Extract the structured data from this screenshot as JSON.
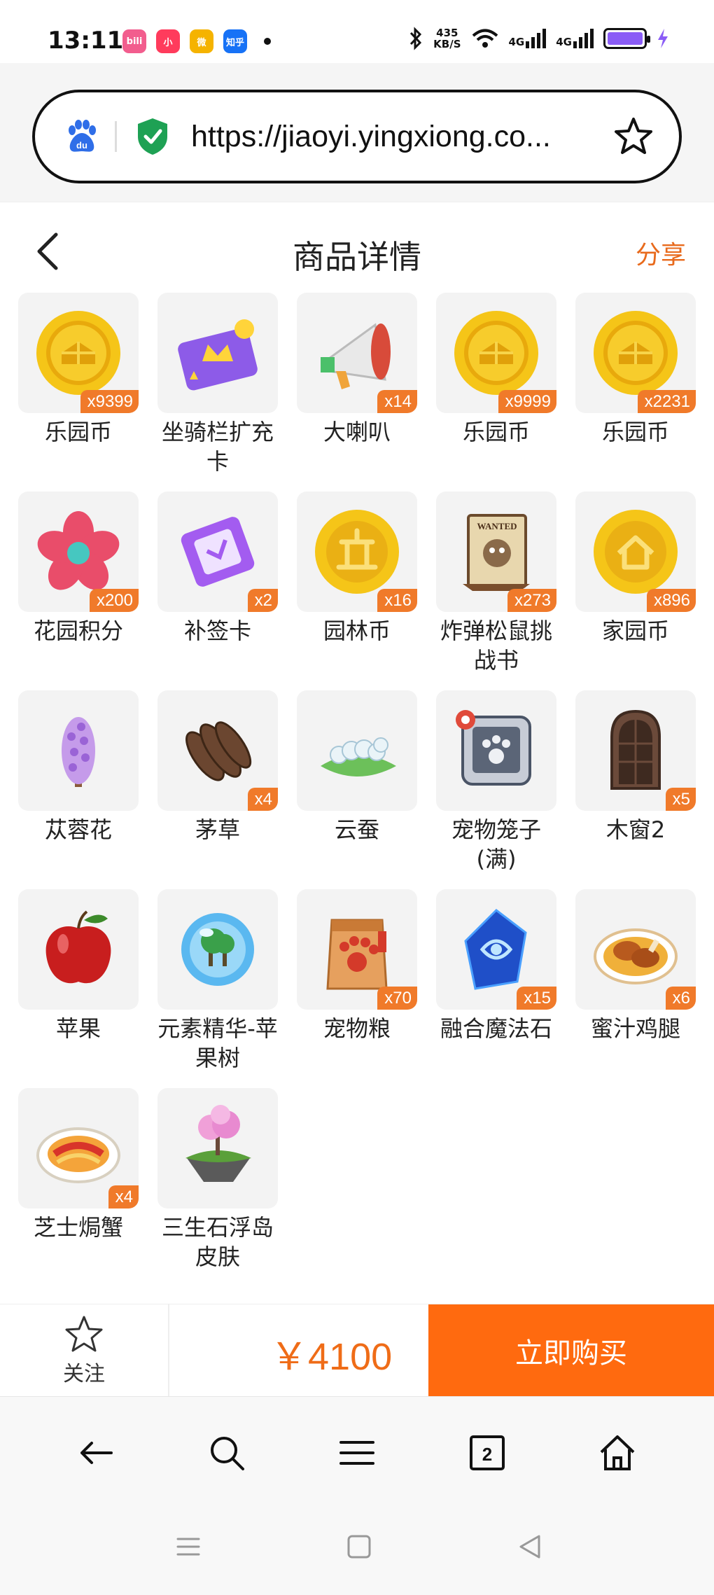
{
  "status_bar": {
    "time": "13:11",
    "net_speed_value": "435",
    "net_speed_unit": "KB/S",
    "network_label": "4G",
    "apps": [
      {
        "label": "bili",
        "color": "#f25d8e"
      },
      {
        "label": "小",
        "color": "#ff3b5c"
      },
      {
        "label": "微",
        "color": "#f5b300"
      },
      {
        "label": "知乎",
        "color": "#1772f6"
      }
    ],
    "battery_color": "#8a5cf6"
  },
  "browser": {
    "url": "https://jiaoyi.yingxiong.co..."
  },
  "header": {
    "title": "商品详情",
    "share_label": "分享"
  },
  "items": [
    {
      "name": "乐园币",
      "qty": "x9399",
      "icon": "coin-icon"
    },
    {
      "name": "坐骑栏扩充卡",
      "qty": "",
      "icon": "mount-card-icon"
    },
    {
      "name": "大喇叭",
      "qty": "x14",
      "icon": "megaphone-icon"
    },
    {
      "name": "乐园币",
      "qty": "x9999",
      "icon": "coin-icon"
    },
    {
      "name": "乐园币",
      "qty": "x2231",
      "icon": "coin-icon"
    },
    {
      "name": "花园积分",
      "qty": "x200",
      "icon": "flower-points-icon"
    },
    {
      "name": "补签卡",
      "qty": "x2",
      "icon": "makeup-card-icon"
    },
    {
      "name": "园林币",
      "qty": "x16",
      "icon": "garden-coin-icon"
    },
    {
      "name": "炸弹松鼠挑战书",
      "qty": "x273",
      "icon": "wanted-poster-icon"
    },
    {
      "name": "家园币",
      "qty": "x896",
      "icon": "home-coin-icon"
    },
    {
      "name": "苁蓉花",
      "qty": "",
      "icon": "cistanche-flower-icon"
    },
    {
      "name": "茅草",
      "qty": "x4",
      "icon": "thatch-icon"
    },
    {
      "name": "云蚕",
      "qty": "",
      "icon": "silkworm-icon"
    },
    {
      "name": "宠物笼子(满)",
      "qty": "",
      "icon": "pet-cage-icon"
    },
    {
      "name": "木窗2",
      "qty": "x5",
      "icon": "wooden-window-icon"
    },
    {
      "name": "苹果",
      "qty": "",
      "icon": "apple-icon"
    },
    {
      "name": "元素精华-苹果树",
      "qty": "",
      "icon": "element-essence-icon"
    },
    {
      "name": "宠物粮",
      "qty": "x70",
      "icon": "pet-food-icon"
    },
    {
      "name": "融合魔法石",
      "qty": "x15",
      "icon": "magic-stone-icon"
    },
    {
      "name": "蜜汁鸡腿",
      "qty": "x6",
      "icon": "honey-drumstick-icon"
    },
    {
      "name": "芝士焗蟹",
      "qty": "x4",
      "icon": "cheese-crab-icon"
    },
    {
      "name": "三生石浮岛皮肤",
      "qty": "",
      "icon": "floating-island-icon"
    }
  ],
  "purchase": {
    "follow_label": "关注",
    "price": "￥4100",
    "buy_label": "立即购买"
  },
  "browser_nav": {
    "tab_count": "2"
  },
  "colors": {
    "accent": "#ff6a0f",
    "price": "#ef6c17",
    "badge": "#f07a2a"
  }
}
